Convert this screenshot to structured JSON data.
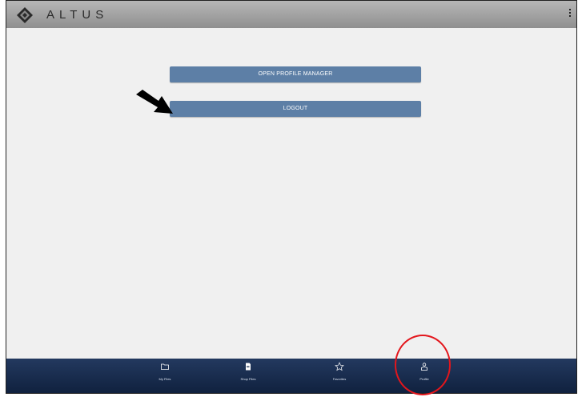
{
  "app": {
    "name": "ALTUS"
  },
  "header": {
    "menu_icon": "kebab-menu-icon"
  },
  "main": {
    "buttons": [
      {
        "label": "OPEN PROFILE MANAGER"
      },
      {
        "label": "LOGOUT"
      }
    ]
  },
  "bottom_nav": {
    "items": [
      {
        "label": "My Files",
        "icon": "folder-icon"
      },
      {
        "label": "Shop Files",
        "icon": "document-icon"
      },
      {
        "label": "Favorites",
        "icon": "star-icon"
      },
      {
        "label": "Profile",
        "icon": "user-icon"
      }
    ]
  },
  "colors": {
    "topbar": "#9e9e9e",
    "button": "#5d7fa6",
    "nav_bar": "#1b2f52",
    "highlight_circle": "#e3161c"
  }
}
